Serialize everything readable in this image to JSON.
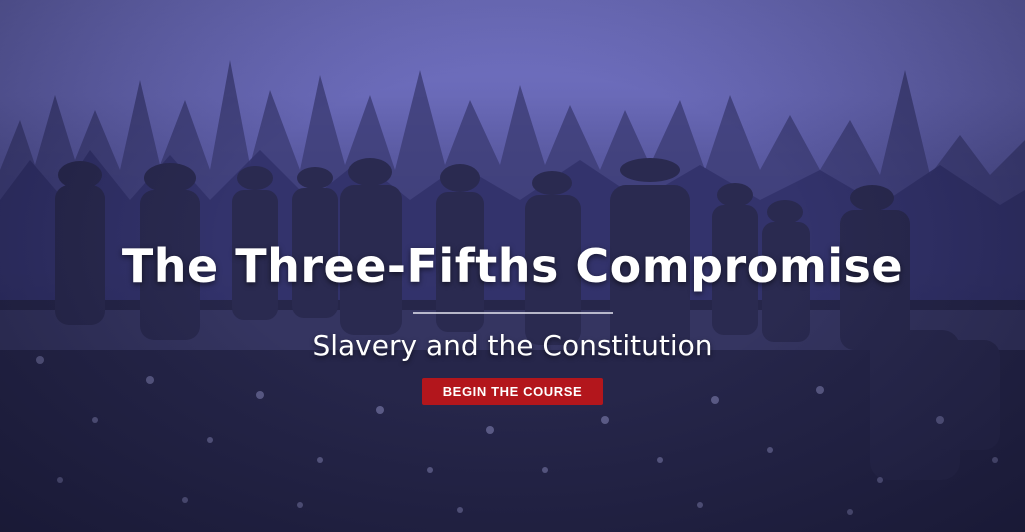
{
  "hero": {
    "title": "The Three-Fifths Compromise",
    "subtitle": "Slavery and the Constitution",
    "cta_label": "BEGIN THE COURSE",
    "background_image": "historical-photo-cotton-field-workers"
  },
  "colors": {
    "tint": "#6a6ab8",
    "cta_background": "#b3161c",
    "text": "#ffffff"
  }
}
